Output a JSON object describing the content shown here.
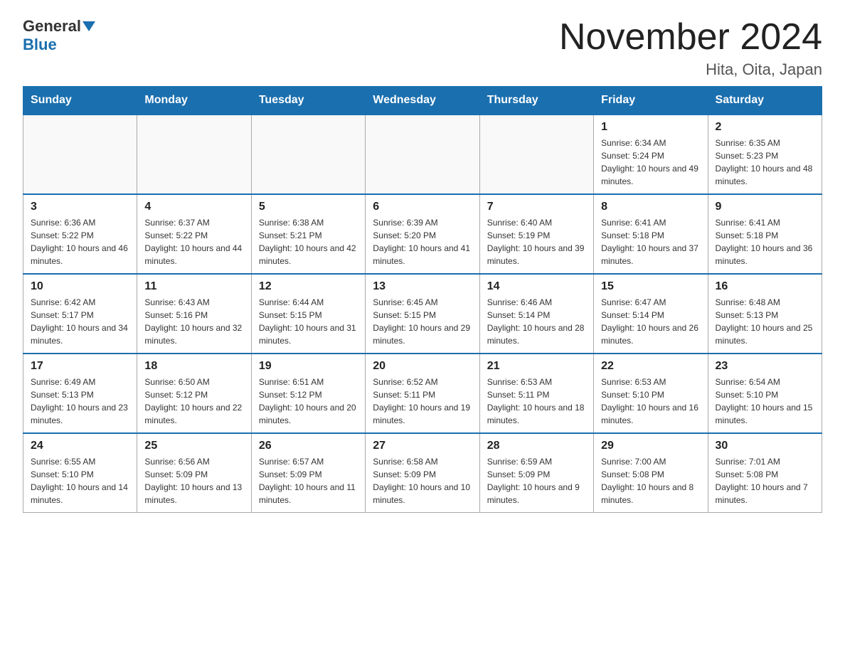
{
  "header": {
    "logo_general": "General",
    "logo_blue": "Blue",
    "month_title": "November 2024",
    "location": "Hita, Oita, Japan"
  },
  "weekdays": [
    "Sunday",
    "Monday",
    "Tuesday",
    "Wednesday",
    "Thursday",
    "Friday",
    "Saturday"
  ],
  "weeks": [
    [
      {
        "day": "",
        "info": ""
      },
      {
        "day": "",
        "info": ""
      },
      {
        "day": "",
        "info": ""
      },
      {
        "day": "",
        "info": ""
      },
      {
        "day": "",
        "info": ""
      },
      {
        "day": "1",
        "info": "Sunrise: 6:34 AM\nSunset: 5:24 PM\nDaylight: 10 hours and 49 minutes."
      },
      {
        "day": "2",
        "info": "Sunrise: 6:35 AM\nSunset: 5:23 PM\nDaylight: 10 hours and 48 minutes."
      }
    ],
    [
      {
        "day": "3",
        "info": "Sunrise: 6:36 AM\nSunset: 5:22 PM\nDaylight: 10 hours and 46 minutes."
      },
      {
        "day": "4",
        "info": "Sunrise: 6:37 AM\nSunset: 5:22 PM\nDaylight: 10 hours and 44 minutes."
      },
      {
        "day": "5",
        "info": "Sunrise: 6:38 AM\nSunset: 5:21 PM\nDaylight: 10 hours and 42 minutes."
      },
      {
        "day": "6",
        "info": "Sunrise: 6:39 AM\nSunset: 5:20 PM\nDaylight: 10 hours and 41 minutes."
      },
      {
        "day": "7",
        "info": "Sunrise: 6:40 AM\nSunset: 5:19 PM\nDaylight: 10 hours and 39 minutes."
      },
      {
        "day": "8",
        "info": "Sunrise: 6:41 AM\nSunset: 5:18 PM\nDaylight: 10 hours and 37 minutes."
      },
      {
        "day": "9",
        "info": "Sunrise: 6:41 AM\nSunset: 5:18 PM\nDaylight: 10 hours and 36 minutes."
      }
    ],
    [
      {
        "day": "10",
        "info": "Sunrise: 6:42 AM\nSunset: 5:17 PM\nDaylight: 10 hours and 34 minutes."
      },
      {
        "day": "11",
        "info": "Sunrise: 6:43 AM\nSunset: 5:16 PM\nDaylight: 10 hours and 32 minutes."
      },
      {
        "day": "12",
        "info": "Sunrise: 6:44 AM\nSunset: 5:15 PM\nDaylight: 10 hours and 31 minutes."
      },
      {
        "day": "13",
        "info": "Sunrise: 6:45 AM\nSunset: 5:15 PM\nDaylight: 10 hours and 29 minutes."
      },
      {
        "day": "14",
        "info": "Sunrise: 6:46 AM\nSunset: 5:14 PM\nDaylight: 10 hours and 28 minutes."
      },
      {
        "day": "15",
        "info": "Sunrise: 6:47 AM\nSunset: 5:14 PM\nDaylight: 10 hours and 26 minutes."
      },
      {
        "day": "16",
        "info": "Sunrise: 6:48 AM\nSunset: 5:13 PM\nDaylight: 10 hours and 25 minutes."
      }
    ],
    [
      {
        "day": "17",
        "info": "Sunrise: 6:49 AM\nSunset: 5:13 PM\nDaylight: 10 hours and 23 minutes."
      },
      {
        "day": "18",
        "info": "Sunrise: 6:50 AM\nSunset: 5:12 PM\nDaylight: 10 hours and 22 minutes."
      },
      {
        "day": "19",
        "info": "Sunrise: 6:51 AM\nSunset: 5:12 PM\nDaylight: 10 hours and 20 minutes."
      },
      {
        "day": "20",
        "info": "Sunrise: 6:52 AM\nSunset: 5:11 PM\nDaylight: 10 hours and 19 minutes."
      },
      {
        "day": "21",
        "info": "Sunrise: 6:53 AM\nSunset: 5:11 PM\nDaylight: 10 hours and 18 minutes."
      },
      {
        "day": "22",
        "info": "Sunrise: 6:53 AM\nSunset: 5:10 PM\nDaylight: 10 hours and 16 minutes."
      },
      {
        "day": "23",
        "info": "Sunrise: 6:54 AM\nSunset: 5:10 PM\nDaylight: 10 hours and 15 minutes."
      }
    ],
    [
      {
        "day": "24",
        "info": "Sunrise: 6:55 AM\nSunset: 5:10 PM\nDaylight: 10 hours and 14 minutes."
      },
      {
        "day": "25",
        "info": "Sunrise: 6:56 AM\nSunset: 5:09 PM\nDaylight: 10 hours and 13 minutes."
      },
      {
        "day": "26",
        "info": "Sunrise: 6:57 AM\nSunset: 5:09 PM\nDaylight: 10 hours and 11 minutes."
      },
      {
        "day": "27",
        "info": "Sunrise: 6:58 AM\nSunset: 5:09 PM\nDaylight: 10 hours and 10 minutes."
      },
      {
        "day": "28",
        "info": "Sunrise: 6:59 AM\nSunset: 5:09 PM\nDaylight: 10 hours and 9 minutes."
      },
      {
        "day": "29",
        "info": "Sunrise: 7:00 AM\nSunset: 5:08 PM\nDaylight: 10 hours and 8 minutes."
      },
      {
        "day": "30",
        "info": "Sunrise: 7:01 AM\nSunset: 5:08 PM\nDaylight: 10 hours and 7 minutes."
      }
    ]
  ]
}
